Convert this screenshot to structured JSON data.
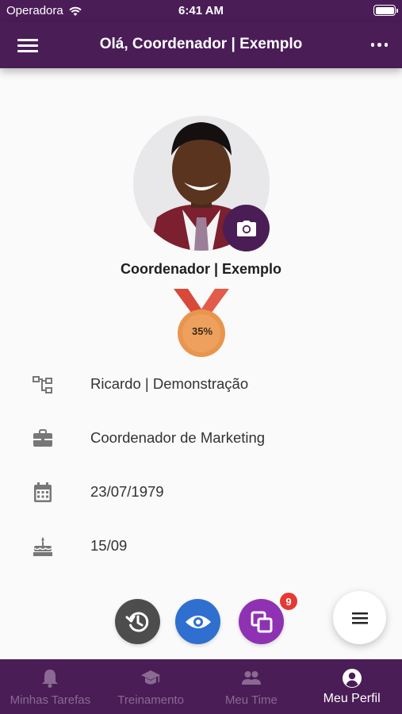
{
  "status_bar": {
    "carrier": "Operadora",
    "time": "6:41 AM"
  },
  "header": {
    "title": "Olá, Coordenador | Exemplo"
  },
  "profile": {
    "name": "Coordenador | Exemplo",
    "medal_percent": "35%"
  },
  "info": [
    {
      "icon": "org-chart-icon",
      "text": "Ricardo | Demonstração"
    },
    {
      "icon": "briefcase-icon",
      "text": "Coordenador de Marketing"
    },
    {
      "icon": "calendar-icon",
      "text": "23/07/1979"
    },
    {
      "icon": "birthday-cake-icon",
      "text": "15/09"
    }
  ],
  "actions": {
    "history": {
      "icon": "history-icon",
      "color": "#4d4d4d"
    },
    "view": {
      "icon": "eye-icon",
      "color": "#2f6fcf"
    },
    "copy": {
      "icon": "copy-icon",
      "color": "#8e32b3",
      "badge": "9"
    },
    "menu": {
      "icon": "menu-icon"
    }
  },
  "nav": [
    {
      "label": "Minhas Tarefas",
      "icon": "bell-icon",
      "active": false
    },
    {
      "label": "Treinamento",
      "icon": "graduation-cap-icon",
      "active": false
    },
    {
      "label": "Meu Time",
      "icon": "team-icon",
      "active": false
    },
    {
      "label": "Meu Perfil",
      "icon": "account-circle-icon",
      "active": true
    }
  ],
  "colors": {
    "primary": "#4a1d57",
    "badge": "#e53935",
    "medal": "#e9954d"
  }
}
